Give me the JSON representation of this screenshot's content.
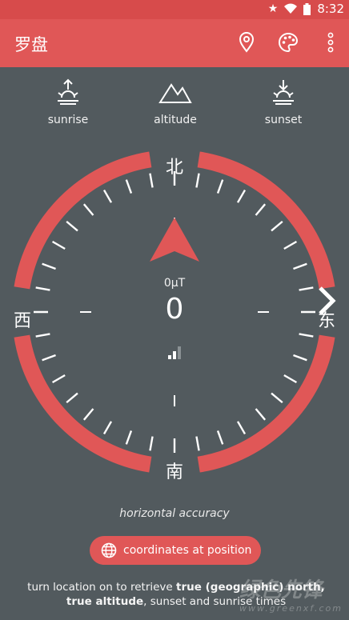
{
  "status_bar": {
    "time": "8:32"
  },
  "app_bar": {
    "title": "罗盘",
    "actions": [
      {
        "icon": "location-pin-icon"
      },
      {
        "icon": "palette-icon"
      },
      {
        "icon": "more-vert-icon"
      }
    ]
  },
  "info": {
    "sunrise_label": "sunrise",
    "altitude_label": "altitude",
    "sunset_label": "sunset"
  },
  "compass": {
    "north": "北",
    "south": "南",
    "east": "东",
    "west": "西",
    "field_strength": "0μT",
    "heading": "0"
  },
  "accuracy_label": "horizontal accuracy",
  "coordinates_button": "coordinates at position",
  "hint": {
    "prefix": "turn location on to retrieve ",
    "bold1": "true (geographic) north, true altitude",
    "middle": ", sunset and sunrise times"
  },
  "watermark": {
    "brand": "绿色先锋",
    "url": "www.greenxf.com"
  },
  "colors": {
    "accent": "#e05757",
    "background": "#525a5e",
    "status": "#d74b4b"
  }
}
